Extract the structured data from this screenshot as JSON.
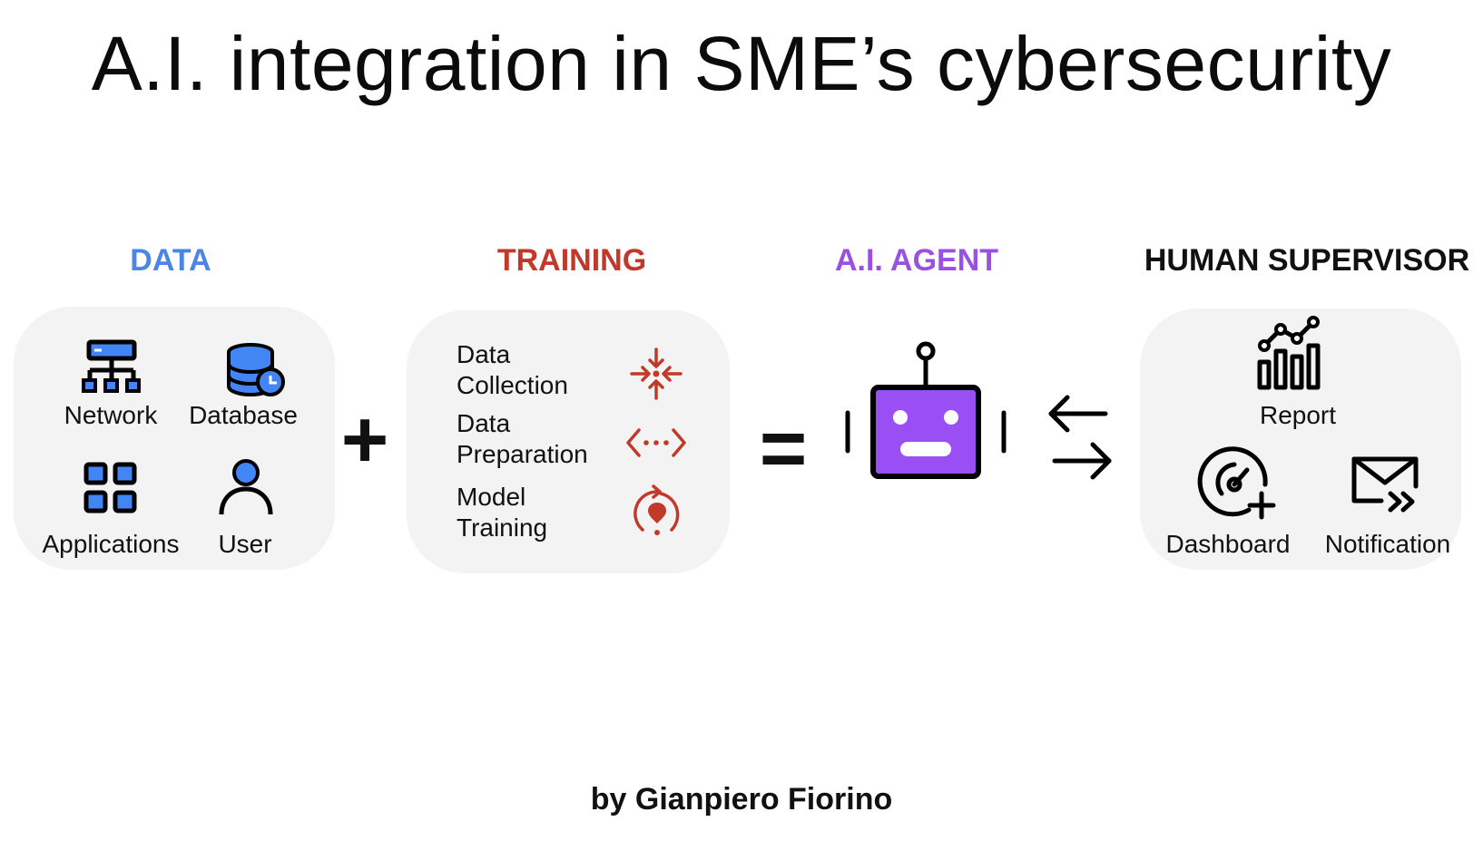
{
  "title": "A.I. integration in SME’s cybersecurity",
  "author": "by Gianpiero Fiorino",
  "operators": {
    "plus": "+",
    "equals": "="
  },
  "colors": {
    "data": "#4a86e8",
    "training": "#c0392b",
    "agent": "#9b51e0",
    "supervisor": "#111111",
    "card_bg": "#f3f3f3",
    "icon_blue": "#4285f4",
    "robot_face": "#9a4ff5"
  },
  "sections": {
    "data": {
      "title": "DATA",
      "items": [
        {
          "label": "Network",
          "icon": "network-icon"
        },
        {
          "label": "Database",
          "icon": "database-icon"
        },
        {
          "label": "Applications",
          "icon": "applications-icon"
        },
        {
          "label": "User",
          "icon": "user-icon"
        }
      ]
    },
    "training": {
      "title": "TRAINING",
      "items": [
        {
          "label_line1": "Data",
          "label_line2": "Collection",
          "icon": "collect-icon"
        },
        {
          "label_line1": "Data",
          "label_line2": "Preparation",
          "icon": "code-icon"
        },
        {
          "label_line1": "Model",
          "label_line2": "Training",
          "icon": "refresh-icon"
        }
      ]
    },
    "agent": {
      "title": "A.I. AGENT",
      "icon": "robot-icon"
    },
    "supervisor": {
      "title": "HUMAN SUPERVISOR",
      "items": [
        {
          "label": "Report",
          "icon": "chart-icon"
        },
        {
          "label": "Dashboard",
          "icon": "gauge-icon"
        },
        {
          "label": "Notification",
          "icon": "mail-icon"
        }
      ]
    }
  }
}
